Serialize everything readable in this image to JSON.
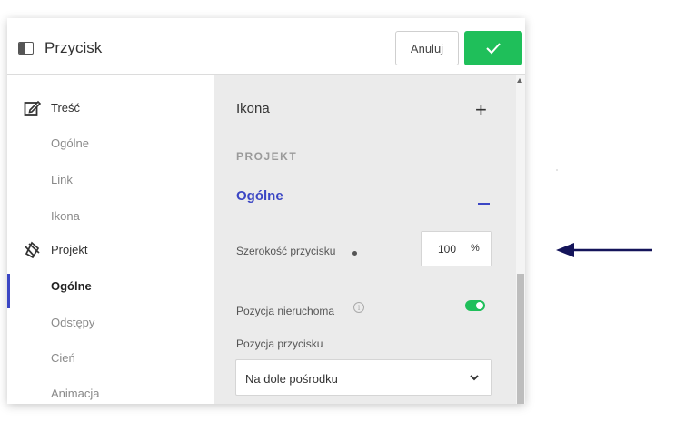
{
  "header": {
    "title": "Przycisk",
    "cancel_label": "Anuluj",
    "confirm_icon": "check-icon"
  },
  "sidebar": {
    "items": [
      {
        "label": "Treść",
        "type": "section",
        "icon": "edit-icon"
      },
      {
        "label": "Ogólne",
        "type": "item"
      },
      {
        "label": "Link",
        "type": "item"
      },
      {
        "label": "Ikona",
        "type": "item"
      },
      {
        "label": "Projekt",
        "type": "section",
        "icon": "design-icon"
      },
      {
        "label": "Ogólne",
        "type": "item",
        "active": true
      },
      {
        "label": "Odstępy",
        "type": "item"
      },
      {
        "label": "Cień",
        "type": "item"
      },
      {
        "label": "Animacja",
        "type": "item"
      }
    ]
  },
  "content": {
    "icon_section": {
      "title": "Ikona",
      "expand_symbol": "+"
    },
    "group_label": "PROJEKT",
    "general_section": {
      "title": "Ogólne"
    },
    "button_width": {
      "label": "Szerokość przycisku",
      "value": "100",
      "unit": "%"
    },
    "fixed_position": {
      "label": "Pozycja nieruchoma",
      "info_symbol": "i",
      "enabled": true
    },
    "button_position": {
      "label": "Pozycja przycisku",
      "selected": "Na dole pośrodku"
    }
  },
  "colors": {
    "accent_green": "#1fbf5a",
    "accent_blue": "#3b46c4",
    "arrow": "#14145a"
  }
}
